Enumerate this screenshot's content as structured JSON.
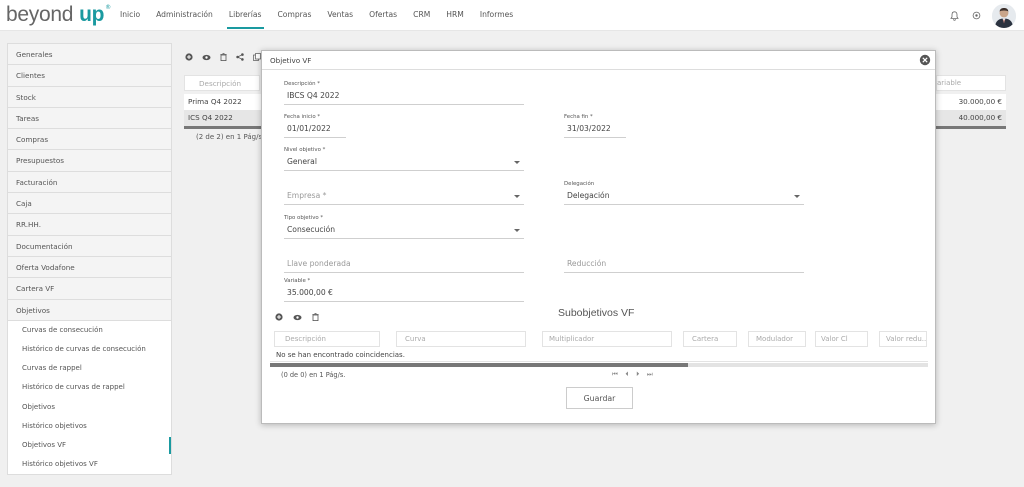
{
  "brand": {
    "name_part1": "beyond",
    "name_part2": "up",
    "reg": "®"
  },
  "nav": {
    "items": [
      {
        "label": "Inicio",
        "active": false
      },
      {
        "label": "Administración",
        "active": false
      },
      {
        "label": "Librerías",
        "active": true
      },
      {
        "label": "Compras",
        "active": false
      },
      {
        "label": "Ventas",
        "active": false
      },
      {
        "label": "Ofertas",
        "active": false
      },
      {
        "label": "CRM",
        "active": false
      },
      {
        "label": "HRM",
        "active": false
      },
      {
        "label": "Informes",
        "active": false
      }
    ]
  },
  "top_icons": [
    "bell-icon",
    "gear-icon",
    "user-avatar"
  ],
  "sidebar": {
    "sections": [
      "Generales",
      "Clientes",
      "Stock",
      "Tareas",
      "Compras",
      "Presupuestos",
      "Facturación",
      "Caja",
      "RR.HH.",
      "Documentación",
      "Oferta Vodafone",
      "Cartera VF",
      "Objetivos"
    ],
    "sub_items": [
      {
        "label": "Curvas de consecución",
        "active": false
      },
      {
        "label": "Histórico de curvas de consecución",
        "active": false
      },
      {
        "label": "Curvas de rappel",
        "active": false
      },
      {
        "label": "Histórico de curvas de rappel",
        "active": false
      },
      {
        "label": "Objetivos",
        "active": false
      },
      {
        "label": "Histórico objetivos",
        "active": false
      },
      {
        "label": "Objetivos VF",
        "active": true
      },
      {
        "label": "Histórico objetivos VF",
        "active": false
      }
    ]
  },
  "list": {
    "filter_placeholder": "Descripción",
    "filter_right_placeholder": "ariable",
    "rows": [
      {
        "description": "Prima Q4 2022",
        "variable": "30.000,00 €",
        "selected": false
      },
      {
        "description": "ICS Q4 2022",
        "variable": "40.000,00 €",
        "selected": true
      }
    ],
    "pager": "(2 de 2) en 1 Pág/s."
  },
  "modal": {
    "title": "Objetivo VF",
    "fields": {
      "descripcion": {
        "label": "Descripción *",
        "value": "IBCS Q4 2022"
      },
      "fecha_inicio": {
        "label": "Fecha inicio *",
        "value": "01/01/2022"
      },
      "fecha_fin": {
        "label": "Fecha fin *",
        "value": "31/03/2022"
      },
      "nivel_objetivo": {
        "label": "Nivel objetivo *",
        "value": "General"
      },
      "empresa": {
        "placeholder": "Empresa *"
      },
      "delegacion": {
        "label": "Delegación",
        "value": "Delegación"
      },
      "tipo_objetivo": {
        "label": "Tipo objetivo *",
        "value": "Consecución"
      },
      "llave_ponderada": {
        "placeholder": "Llave ponderada"
      },
      "reduccion": {
        "placeholder": "Reducción"
      },
      "variable": {
        "label": "Variable *",
        "value": "35.000,00 €"
      }
    },
    "subobjetivos": {
      "title": "Subobjetivos VF",
      "columns": [
        "Descripción",
        "Curva",
        "Multiplicador",
        "Cartera",
        "Modulador",
        "Valor Cl",
        "Valor redu..."
      ],
      "empty_message": "No se han encontrado coincidencias.",
      "pager": "(0 de 0) en 1 Pág/s.",
      "pager_buttons": [
        "⏮",
        "⏴",
        "⏵",
        "⏭"
      ]
    },
    "save_label": "Guardar"
  },
  "colors": {
    "accent": "#1a9aa0",
    "brand_grey": "#666666"
  }
}
